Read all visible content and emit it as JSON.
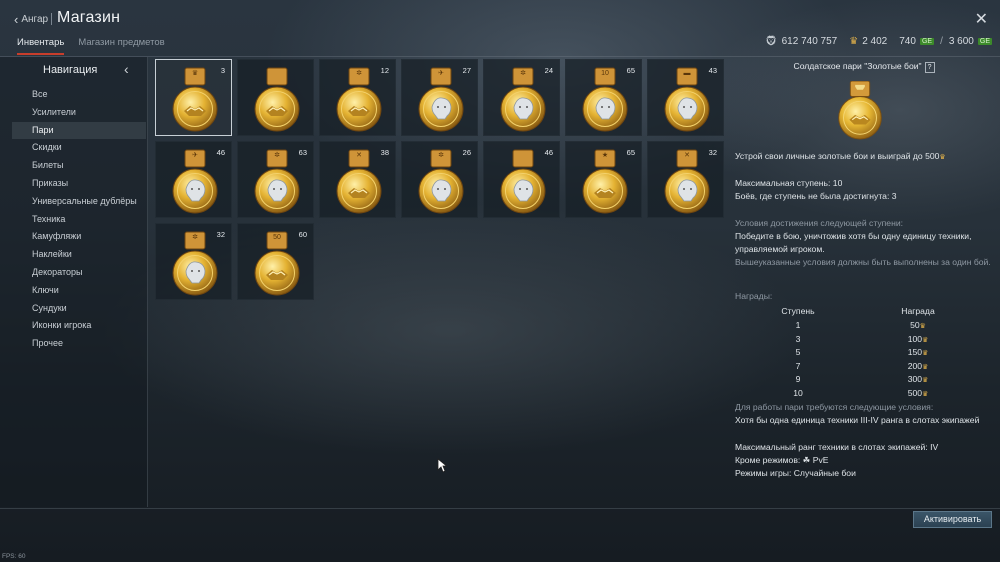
{
  "header": {
    "back_label": "Ангар",
    "title": "Магазин",
    "tabs": [
      {
        "label": "Инвентарь",
        "active": true
      },
      {
        "label": "Магазин предметов",
        "active": false
      }
    ],
    "currency": {
      "silver_lions": "612 740 757",
      "warbonds": "2 402",
      "golden_eagles": "740",
      "gold_badge": "GE",
      "slash": "/",
      "total": "3 600",
      "total_badge": "GE"
    }
  },
  "sidebar": {
    "title": "Навигация",
    "items": [
      {
        "label": "Все"
      },
      {
        "label": "Усилители"
      },
      {
        "label": "Пари",
        "active": true
      },
      {
        "label": "Скидки"
      },
      {
        "label": "Билеты"
      },
      {
        "label": "Приказы"
      },
      {
        "label": "Универсальные дублёры"
      },
      {
        "label": "Техника"
      },
      {
        "label": "Камуфляжи"
      },
      {
        "label": "Наклейки"
      },
      {
        "label": "Декораторы"
      },
      {
        "label": "Ключи"
      },
      {
        "label": "Сундуки"
      },
      {
        "label": "Иконки игрока"
      },
      {
        "label": "Прочее"
      }
    ]
  },
  "inventory": {
    "tiles": [
      {
        "count": "3",
        "emblem": "crown-icon",
        "face": "handshake-icon",
        "selected": true
      },
      {
        "count": "",
        "emblem": "blank",
        "face": "handshake-icon"
      },
      {
        "count": "12",
        "emblem": "cog-icon",
        "face": "handshake-icon"
      },
      {
        "count": "27",
        "emblem": "plane-icon",
        "face": "lion-icon"
      },
      {
        "count": "24",
        "emblem": "cog-icon",
        "face": "lion-icon"
      },
      {
        "count": "65",
        "emblem": "ten-icon",
        "face": "lion-icon"
      },
      {
        "count": "43",
        "emblem": "tank-icon",
        "face": "lion-icon"
      },
      {
        "count": "46",
        "emblem": "plane-icon",
        "face": "lion-icon"
      },
      {
        "count": "63",
        "emblem": "cog-icon",
        "face": "lion-icon"
      },
      {
        "count": "38",
        "emblem": "crossed-swords-icon",
        "face": "handshake-icon"
      },
      {
        "count": "26",
        "emblem": "cog-icon",
        "face": "lion-icon"
      },
      {
        "count": "46",
        "emblem": "blank",
        "face": "lion-icon"
      },
      {
        "count": "65",
        "emblem": "star-icon",
        "face": "handshake-icon"
      },
      {
        "count": "32",
        "emblem": "crossed-swords-icon",
        "face": "lion-icon"
      },
      {
        "count": "32",
        "emblem": "cog-icon",
        "face": "lion-icon"
      },
      {
        "count": "60",
        "emblem": "fifty-icon",
        "face": "handshake-icon"
      }
    ]
  },
  "details": {
    "title": "Солдатское пари \"Золотые бои\"",
    "help": "?",
    "description": "Устрой свои личные золотые бои и выиграй до 500",
    "max_stage_label": "Максимальная ступень:",
    "max_stage_value": "10",
    "unreached_label": "Боёв, где ступень не была достигнута:",
    "unreached_value": "3",
    "next_stage_header": "Условия достижения следующей ступени:",
    "next_stage_condition": "Победите в бою, уничтожив хотя бы одну единицу техники, управляемой игроком.",
    "next_stage_note": "Вышеуказанные условия должны быть выполнены за один бой.",
    "rewards_header": "Награды:",
    "rewards_col_stage": "Ступень",
    "rewards_col_reward": "Награда",
    "rewards": [
      {
        "stage": "1",
        "reward": "50"
      },
      {
        "stage": "3",
        "reward": "100"
      },
      {
        "stage": "5",
        "reward": "150"
      },
      {
        "stage": "7",
        "reward": "200"
      },
      {
        "stage": "9",
        "reward": "300"
      },
      {
        "stage": "10",
        "reward": "500"
      }
    ],
    "requirements_header": "Для работы пари требуются следующие условия:",
    "req_vehicle": "Хотя бы одна единица техники III-IV ранга в слотах экипажей",
    "req_max_rank": "Максимальный ранг техники в слотах экипажей: IV",
    "req_except": "Кроме режимов: ☘ PvE",
    "req_modes": "Режимы игры: Случайные бои"
  },
  "footer": {
    "activate_label": "Активировать",
    "fps": "FPS: 60"
  },
  "colors": {
    "gold": "#e0b04a",
    "accent_tab": "#c83d2b",
    "button": "#2b4152"
  }
}
